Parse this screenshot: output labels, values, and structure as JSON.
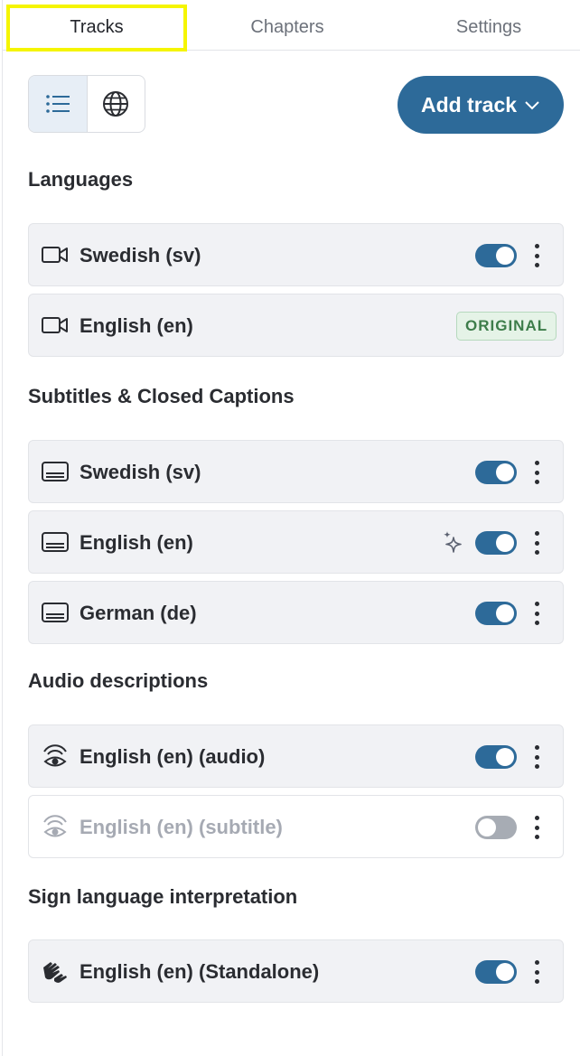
{
  "tabs": [
    {
      "label": "Tracks",
      "active": true
    },
    {
      "label": "Chapters",
      "active": false
    },
    {
      "label": "Settings",
      "active": false
    }
  ],
  "toolbar": {
    "view_list_icon": "list-icon",
    "view_globe_icon": "globe-icon",
    "add_track_label": "Add track"
  },
  "colors": {
    "primary": "#2d6a99",
    "highlight": "#f5f500",
    "badge_bg": "#e5f3e7",
    "badge_text": "#3d7d4a"
  },
  "sections": [
    {
      "title": "Languages",
      "tracks": [
        {
          "label": "Swedish (sv)",
          "icon": "video-camera-icon",
          "toggle": true,
          "menu": true
        },
        {
          "label": "English (en)",
          "icon": "video-camera-icon",
          "badge": "ORIGINAL"
        }
      ]
    },
    {
      "title": "Subtitles & Closed Captions",
      "tracks": [
        {
          "label": "Swedish (sv)",
          "icon": "subtitles-icon",
          "toggle": true,
          "menu": true
        },
        {
          "label": "English (en)",
          "icon": "subtitles-icon",
          "toggle": true,
          "menu": true,
          "extra_icon": "sparkle-icon"
        },
        {
          "label": "German (de)",
          "icon": "subtitles-icon",
          "toggle": true,
          "menu": true
        }
      ]
    },
    {
      "title": "Audio descriptions",
      "tracks": [
        {
          "label": "English (en) (audio)",
          "icon": "audio-description-icon",
          "toggle": true,
          "menu": true
        },
        {
          "label": "English (en) (subtitle)",
          "icon": "audio-description-icon",
          "toggle": false,
          "menu": true,
          "disabled": true
        }
      ]
    },
    {
      "title": "Sign language interpretation",
      "tracks": [
        {
          "label": "English (en) (Standalone)",
          "icon": "sign-language-icon",
          "toggle": true,
          "menu": true
        }
      ]
    }
  ]
}
